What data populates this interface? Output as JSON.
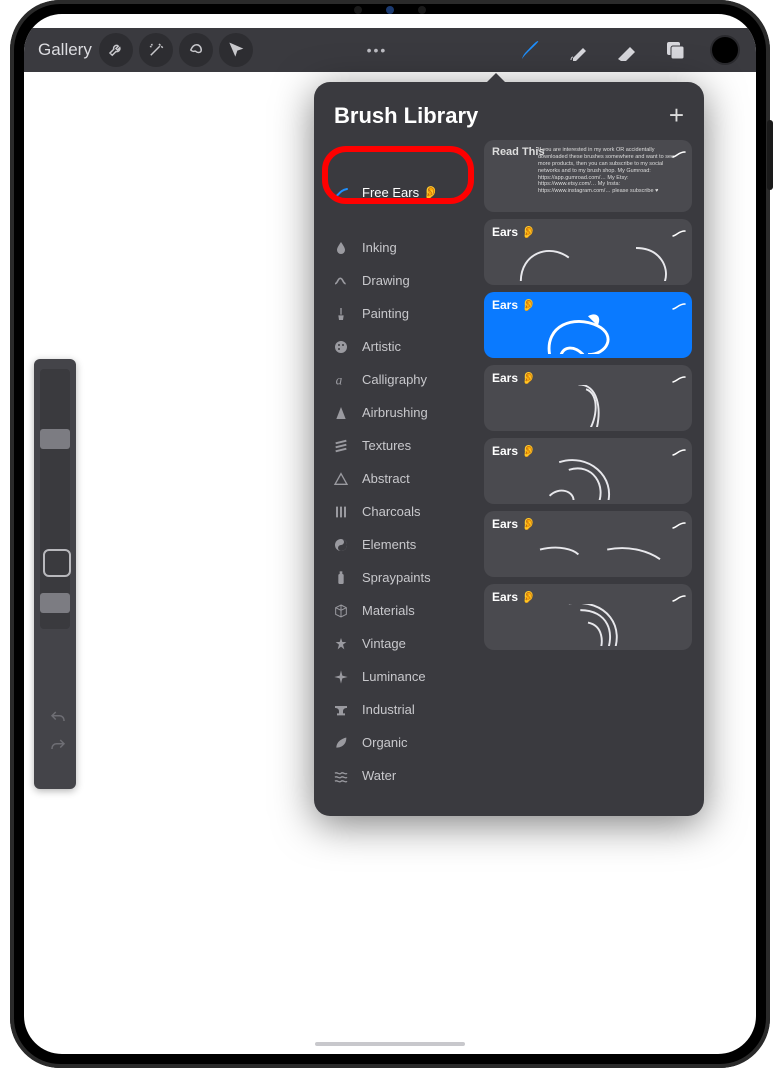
{
  "toolbar": {
    "gallery": "Gallery"
  },
  "popover": {
    "title": "Brush Library",
    "categories": [
      {
        "label": "Free Ears 👂",
        "selected": true,
        "icon": "stroke"
      },
      {
        "label": "Inking",
        "icon": "drop"
      },
      {
        "label": "Drawing",
        "icon": "squiggle"
      },
      {
        "label": "Painting",
        "icon": "brush"
      },
      {
        "label": "Artistic",
        "icon": "palette"
      },
      {
        "label": "Calligraphy",
        "icon": "a"
      },
      {
        "label": "Airbrushing",
        "icon": "spray"
      },
      {
        "label": "Textures",
        "icon": "hatch"
      },
      {
        "label": "Abstract",
        "icon": "triangle"
      },
      {
        "label": "Charcoals",
        "icon": "bars"
      },
      {
        "label": "Elements",
        "icon": "yinyang"
      },
      {
        "label": "Spraypaints",
        "icon": "can"
      },
      {
        "label": "Materials",
        "icon": "cube"
      },
      {
        "label": "Vintage",
        "icon": "star"
      },
      {
        "label": "Luminance",
        "icon": "sparkle"
      },
      {
        "label": "Industrial",
        "icon": "anvil"
      },
      {
        "label": "Organic",
        "icon": "leaf"
      },
      {
        "label": "Water",
        "icon": "waves"
      }
    ],
    "brushes": [
      {
        "name": "Read This",
        "selected": false,
        "kind": "text"
      },
      {
        "name": "Ears 👂",
        "selected": false,
        "kind": "ear1"
      },
      {
        "name": "Ears 👂",
        "selected": true,
        "kind": "ear2"
      },
      {
        "name": "Ears 👂",
        "selected": false,
        "kind": "ear3"
      },
      {
        "name": "Ears 👂",
        "selected": false,
        "kind": "ear4"
      },
      {
        "name": "Ears 👂",
        "selected": false,
        "kind": "ear5"
      },
      {
        "name": "Ears 👂",
        "selected": false,
        "kind": "ear6"
      }
    ],
    "read_this_lines": "If you are interested in my work OR accidentally downloaded these brushes somewhere and want to see more products, then you can subscribe to my social networks and to my brush shop. My Gumroad: https://app.gumroad.com/…  My Etsy: https://www.etsy.com/…  My Insta: https://www.instagram.com/…  please subscribe ♥"
  }
}
